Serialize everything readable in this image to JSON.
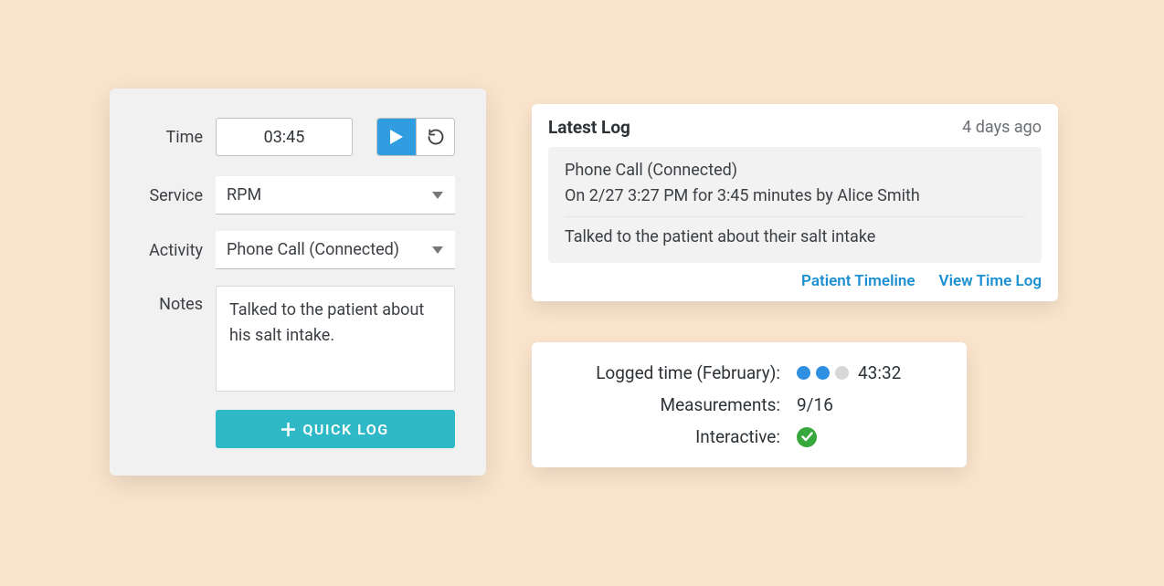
{
  "form": {
    "labels": {
      "time": "Time",
      "service": "Service",
      "activity": "Activity",
      "notes": "Notes"
    },
    "time_value": "03:45",
    "service_value": "RPM",
    "activity_value": "Phone Call (Connected)",
    "notes_value": "Talked to the patient about his salt intake.",
    "submit_label": "QUICK LOG"
  },
  "latest_log": {
    "title": "Latest Log",
    "age": "4 days ago",
    "activity_line": "Phone Call (Connected)",
    "detail_line": "On 2/27 3:27 PM for 3:45 minutes by Alice Smith",
    "note_line": "Talked to the patient about their salt intake",
    "links": {
      "timeline": "Patient Timeline",
      "timelog": "View Time Log"
    }
  },
  "stats": {
    "logged_label": "Logged time (February):",
    "logged_value": "43:32",
    "measurements_label": "Measurements:",
    "measurements_value": "9/16",
    "interactive_label": "Interactive:"
  }
}
